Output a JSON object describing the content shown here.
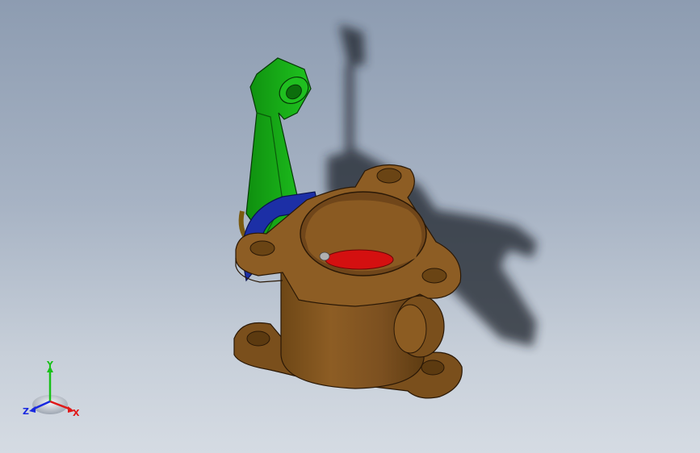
{
  "viewport": {
    "background_top": "#8d9cb1",
    "background_bottom": "#d5dbe3"
  },
  "model": {
    "parts": [
      {
        "name": "valve-body",
        "color": "#8a5a22"
      },
      {
        "name": "lever-arm",
        "color": "#16b516"
      },
      {
        "name": "seal-ring",
        "color": "#1b2ea8"
      },
      {
        "name": "valve-disc",
        "color": "#d10f0f"
      }
    ]
  },
  "triad": {
    "x_label": "X",
    "y_label": "Y",
    "z_label": "Z",
    "x_color": "#e01818",
    "y_color": "#18c018",
    "z_color": "#1828e0"
  }
}
